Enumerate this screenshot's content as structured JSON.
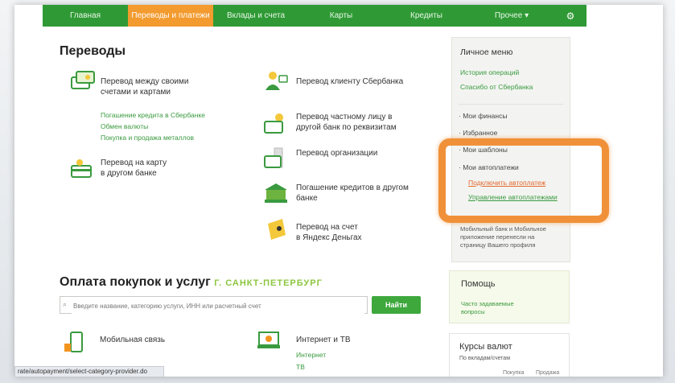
{
  "nav": {
    "items": [
      "Главная",
      "Переводы и платежи",
      "Вклады и счета",
      "Карты",
      "Кредиты",
      "Прочее"
    ],
    "active_index": 1
  },
  "transfers": {
    "title": "Переводы",
    "left": [
      {
        "label_line1": "Перевод между своими",
        "label_line2": "счетами и картами",
        "icon": "card-transfer-icon"
      },
      {
        "label_line1": "Перевод на карту",
        "label_line2": "в другом банке",
        "icon": "card-bank-icon"
      }
    ],
    "sublinks": [
      "Погашение кредита в Сбербанке",
      "Обмен валюты",
      "Покупка и продажа металлов"
    ],
    "right": [
      {
        "label_line1": "Перевод клиенту Сбербанка",
        "label_line2": "",
        "icon": "person-client-icon"
      },
      {
        "label_line1": "Перевод частному лицу в",
        "label_line2": "другой банк по реквизитам",
        "icon": "person-card-icon"
      },
      {
        "label_line1": "Перевод организации",
        "label_line2": "",
        "icon": "organization-icon"
      },
      {
        "label_line1": "Погашение кредитов в другом",
        "label_line2": "банке",
        "icon": "bank-building-icon"
      },
      {
        "label_line1": "Перевод на счет",
        "label_line2": "в Яндекс Деньгах",
        "icon": "yandex-wallet-icon"
      }
    ]
  },
  "payments": {
    "title": "Оплата покупок и услуг",
    "city": "Г. САНКТ-ПЕТЕРБУРГ",
    "search_placeholder": "Введите название, категорию услуги, ИНН или расчетный счет",
    "find_button": "Найти",
    "items": [
      {
        "label": "Мобильная связь",
        "icon": "mobile-icon",
        "sublinks": []
      },
      {
        "label": "Интернет и ТВ",
        "icon": "laptop-icon",
        "sublinks": [
          "Интернет",
          "ТВ"
        ]
      }
    ]
  },
  "personal_menu": {
    "title": "Личное меню",
    "links": [
      "История операций",
      "Спасибо от Сбербанка"
    ],
    "items": [
      "Мои финансы",
      "Избранное",
      "Мои шаблоны",
      "Мои автоплатежи"
    ],
    "autopay_links": [
      "Подключить автоплатеж",
      "Управление автоплатежами"
    ],
    "note_line1": "Мобильный банк и Мобильное",
    "note_line2": "приложение перенесли на",
    "note_line3": "страницу Вашего профиля"
  },
  "help": {
    "title": "Помощь",
    "link_line1": "Часто задаваемые",
    "link_line2": "вопросы"
  },
  "rates": {
    "title": "Курсы валют",
    "subtitle": "По вкладам/счетам",
    "col_buy": "Покупка",
    "col_sell": "Продажа"
  },
  "status_url": "rate/autopayment/select-category-provider.do",
  "colors": {
    "brand_green": "#2f9a35",
    "active_orange": "#f39b2f",
    "highlight_orange": "#f0913a",
    "link_green": "#3a9a3f"
  }
}
